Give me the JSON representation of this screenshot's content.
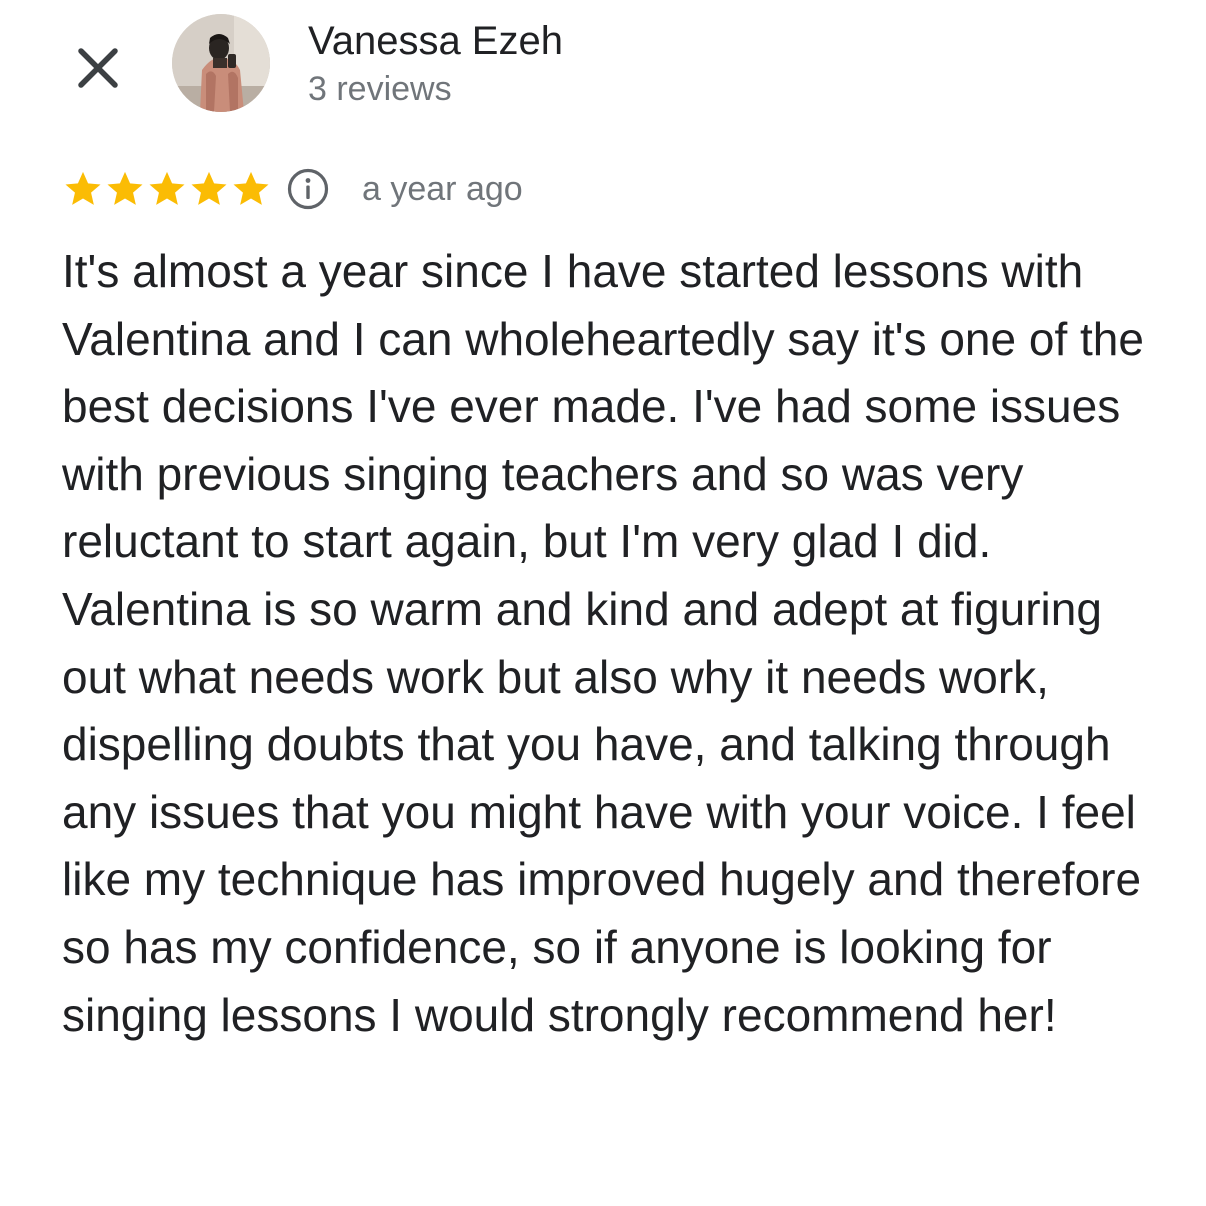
{
  "header": {
    "close_icon": "close-icon",
    "avatar_icon": "avatar",
    "reviewer_name": "Vanessa Ezeh",
    "review_count": "3 reviews"
  },
  "rating": {
    "stars": 5,
    "max_stars": 5,
    "star_color": "#fbbc04",
    "info_icon": "info-icon",
    "time": "a year ago"
  },
  "review": {
    "text": "It's almost a year since I have started lessons with Valentina and I can wholeheartedly say it's one of the best decisions I've ever made. I've had some issues with previous singing teachers and so was very reluctant to start again, but I'm very glad I did. Valentina is so warm and kind and adept at figuring out what needs work but also why it needs work, dispelling doubts that you have, and talking through any issues that you might have with your voice. I feel like my technique has improved hugely and therefore so has my confidence, so if anyone is looking for singing lessons I would strongly recommend her!"
  }
}
